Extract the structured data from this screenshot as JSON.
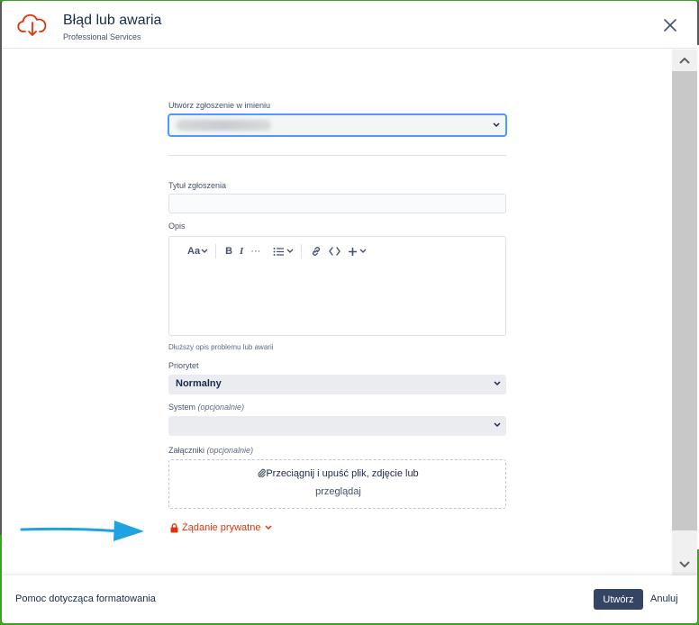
{
  "header": {
    "title": "Błąd lub awaria",
    "subtitle": "Professional Services",
    "accent_color": "#de350b"
  },
  "form": {
    "raise_on_behalf_label": "Utwórz zgłoszenie w imieniu",
    "summary_label": "Tytuł zgłoszenia",
    "description_label": "Opis",
    "description_helper": "Dłuższy opis problemu lub awarii",
    "priority_label": "Priorytet",
    "priority_value": "Normalny",
    "system_label": "System",
    "system_optional": "(opcjonalnie)",
    "attachments_label": "Załączniki",
    "attachments_optional": "(opcjonalnie)",
    "dropzone_text": "Przeciągnij i upuść plik, zdjęcie lub",
    "dropzone_browse": "przeglądaj",
    "private_request": "Żądanie prywatne"
  },
  "editor_toolbar": {
    "text_style": "Aa",
    "bold": "B",
    "italic": "I",
    "more": "···"
  },
  "footer": {
    "help_link": "Pomoc dotycząca formatowania",
    "create_button": "Utwórz",
    "cancel_button": "Anuluj"
  },
  "annotation": {
    "arrow_color": "#1fa3e0"
  }
}
